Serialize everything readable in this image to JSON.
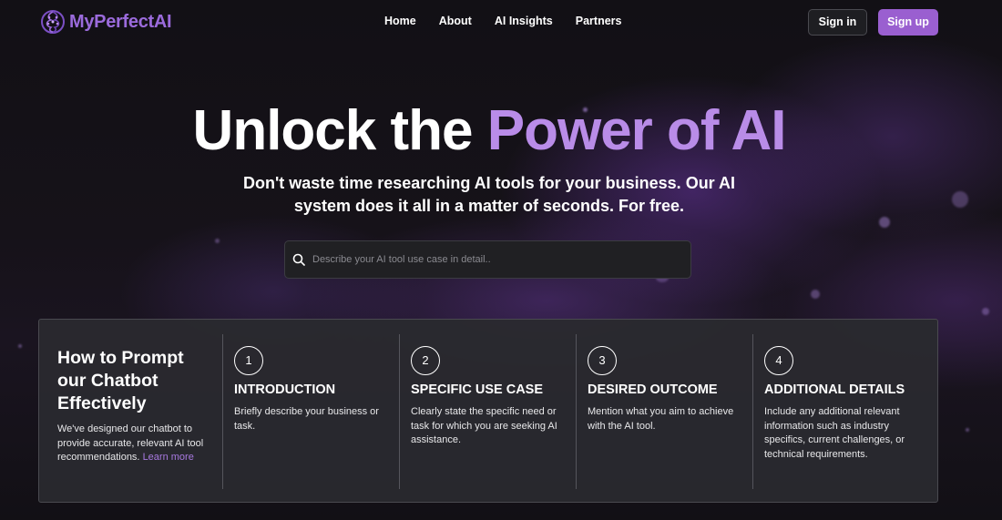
{
  "nav": {
    "logo_text": "MyPerfectAI",
    "links": [
      "Home",
      "About",
      "AI Insights",
      "Partners"
    ],
    "sign_in": "Sign in",
    "sign_up": "Sign up"
  },
  "hero": {
    "title_plain": "Unlock the ",
    "title_accent": "Power of AI",
    "subtitle": "Don't waste time researching AI tools for your business. Our AI system does it all in a matter of seconds. For free.",
    "search_placeholder": "Describe your AI tool use case in detail.."
  },
  "guide": {
    "title": "How to Prompt our Chatbot Effectively",
    "text": "We've designed our chatbot to provide accurate, relevant AI tool recommendations.",
    "link": "Learn more",
    "steps": [
      {
        "number": "1",
        "title": "INTRODUCTION",
        "desc": "Briefly describe your business or task."
      },
      {
        "number": "2",
        "title": "SPECIFIC USE CASE",
        "desc": "Clearly state the specific need or task for which you are seeking AI assistance."
      },
      {
        "number": "3",
        "title": "DESIRED OUTCOME",
        "desc": "Mention what you aim to achieve with the AI tool."
      },
      {
        "number": "4",
        "title": "ADDITIONAL DETAILS",
        "desc": "Include any additional relevant information such as industry specifics, current challenges, or technical requirements."
      }
    ]
  },
  "colors": {
    "accent": "#9a5fd0",
    "title_accent": "#b98ce8",
    "panel_bg": "#2a2a2f"
  },
  "icons": [
    "brain-logo-icon",
    "search-icon"
  ]
}
